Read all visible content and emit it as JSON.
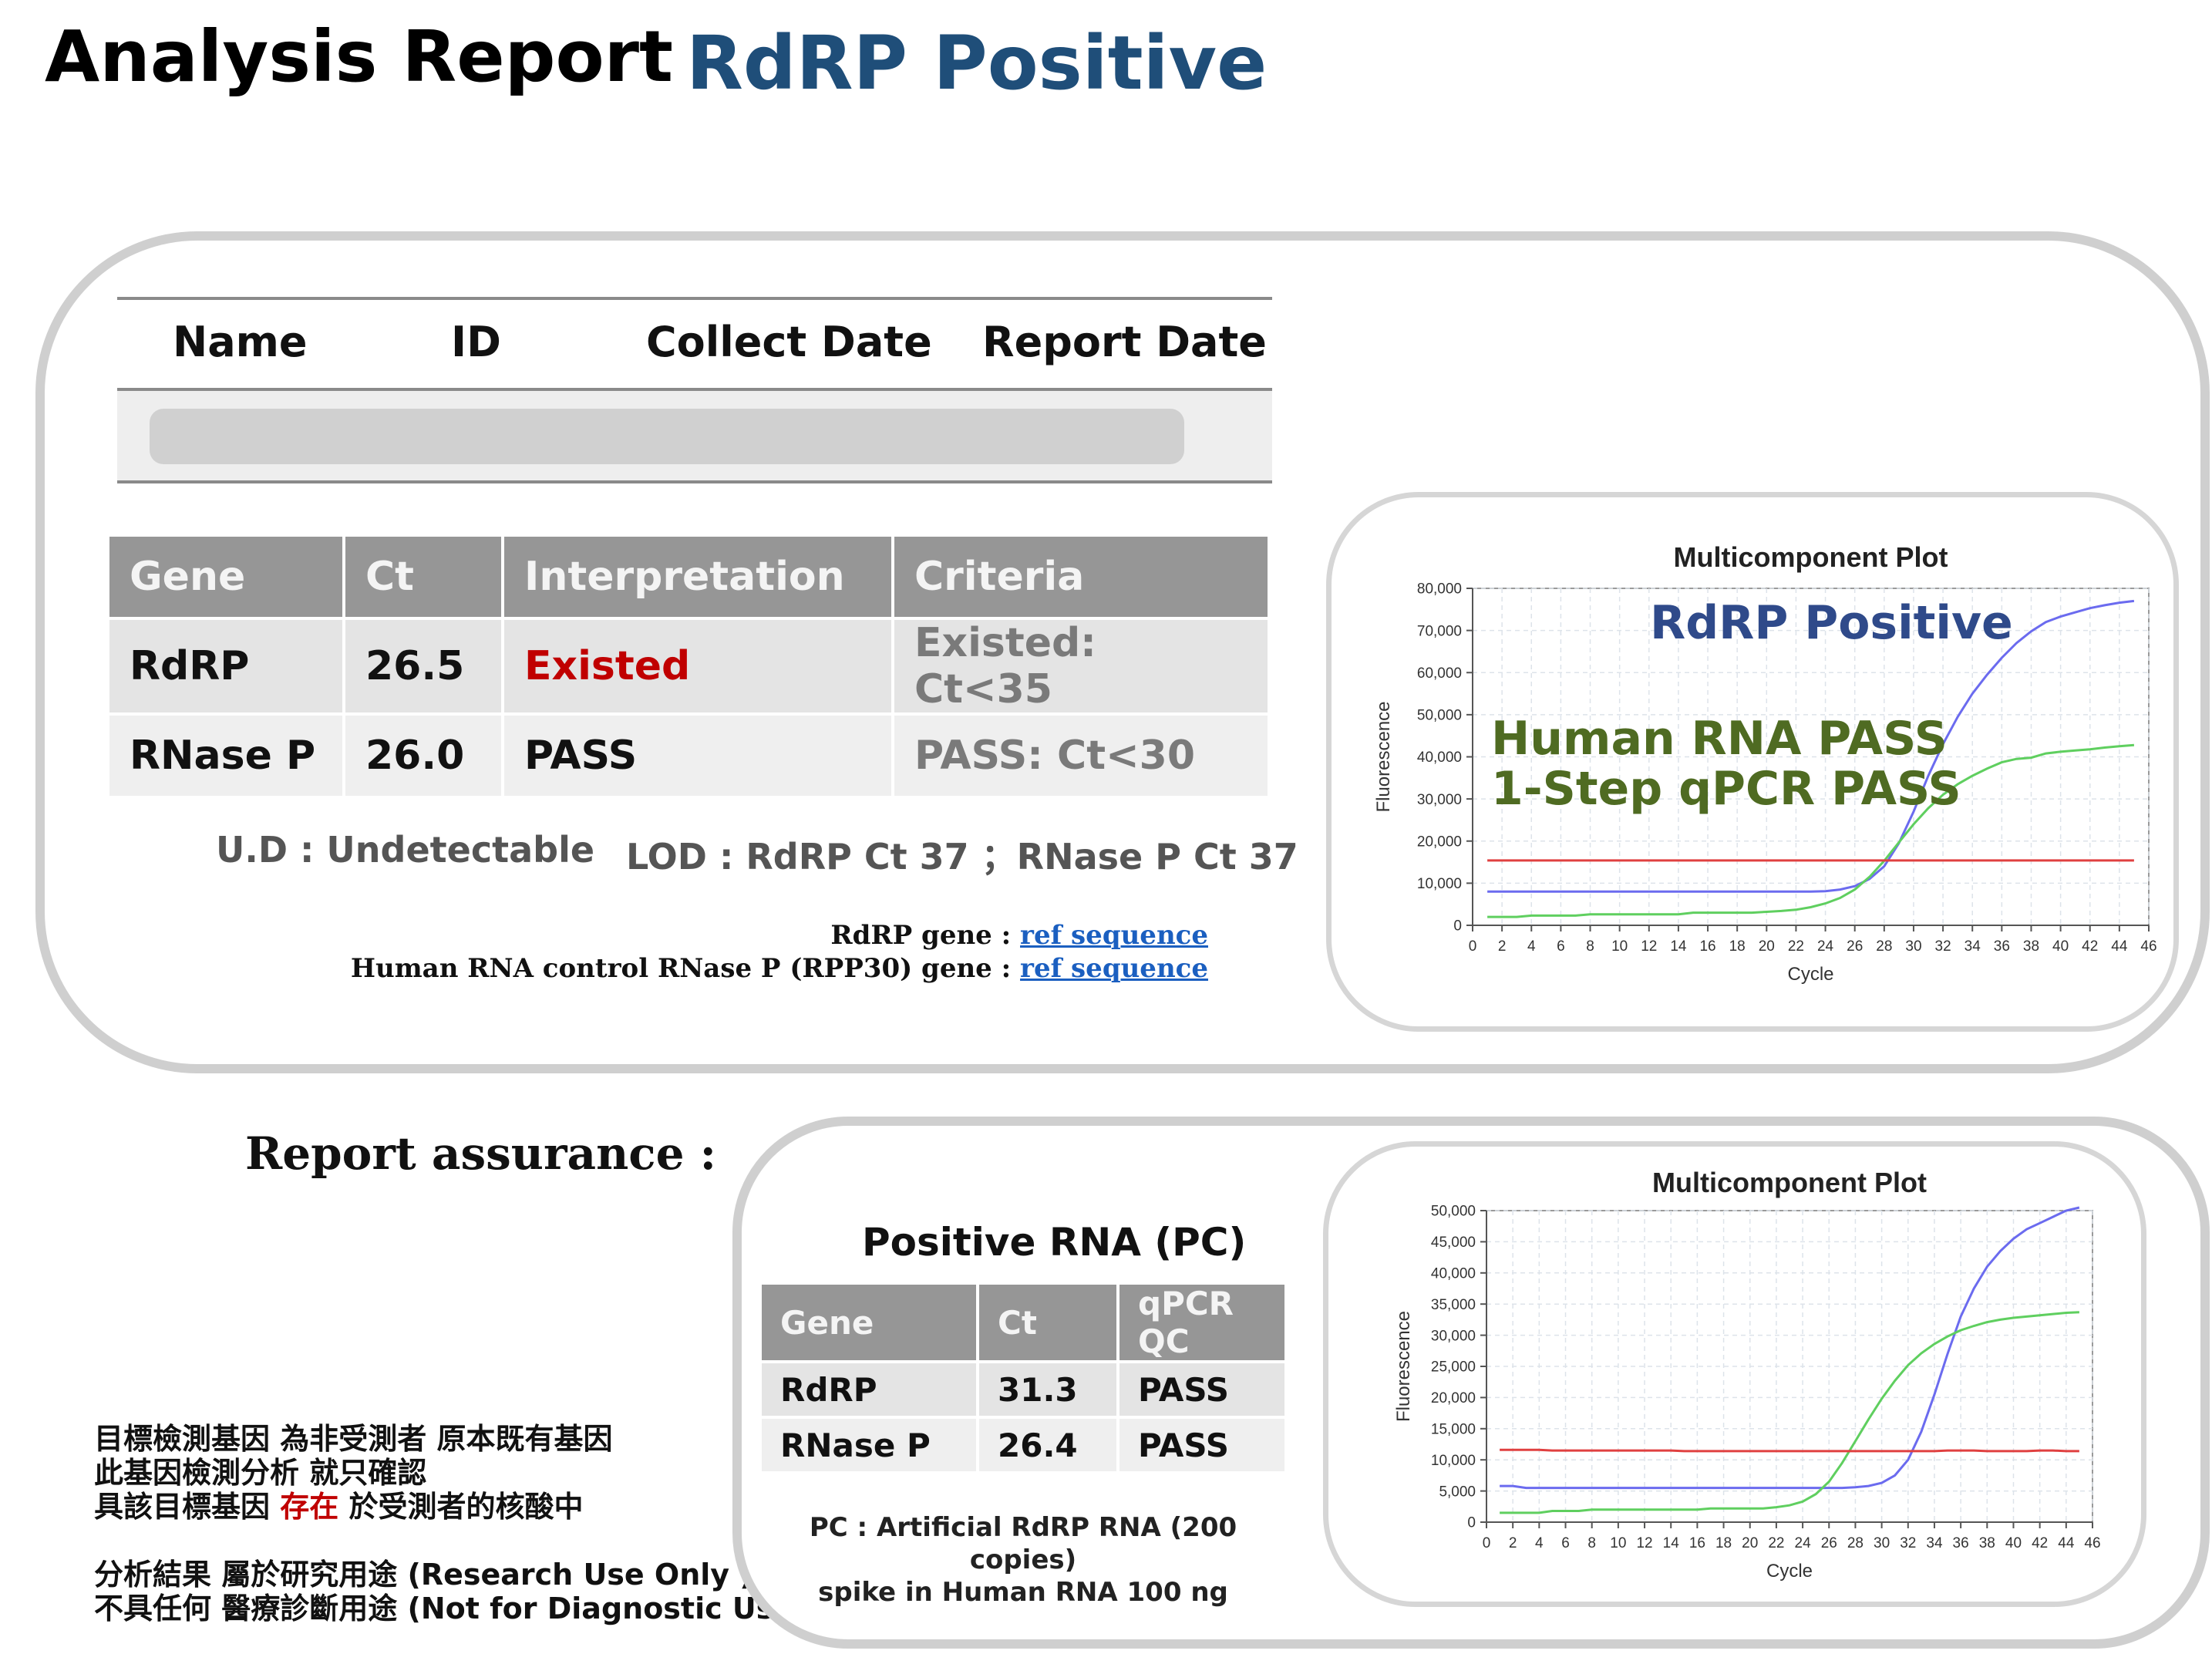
{
  "header": {
    "title": "Analysis Report",
    "subtitle": "RdRP Positive"
  },
  "patient": {
    "columns": [
      "Name",
      "ID",
      "Collect Date",
      "Report Date"
    ]
  },
  "results": {
    "headers": [
      "Gene",
      "Ct",
      "Interpretation",
      "Criteria"
    ],
    "rows": [
      {
        "gene": "RdRP",
        "ct": "26.5",
        "interpretation": "Existed",
        "criteria": "Existed: Ct<35"
      },
      {
        "gene": "RNase P",
        "ct": "26.0",
        "interpretation": "PASS",
        "criteria": "PASS: Ct<30"
      }
    ],
    "note_ud": "U.D : Undetectable",
    "note_lod": "LOD : RdRP Ct 37 ；RNase P Ct 37",
    "ref1_label": "RdRP gene : ",
    "ref2_label": "Human RNA control  RNase P (RPP30) gene : ",
    "ref_link": "ref sequence",
    "colors": {
      "existed": "#c00000",
      "header_bg": "#969696"
    }
  },
  "plot1": {
    "overlay_positive": "RdRP Positive",
    "overlay_human": "Human RNA PASS",
    "overlay_qpcr": "1-Step qPCR PASS"
  },
  "assurance": {
    "title": "Report assurance :",
    "line1": "目標檢測基因 為非受測者 原本既有基因",
    "line2": "此基因檢測分析 就只確認",
    "line3a": "具該目標基因 ",
    "line3b": "存在",
    "line3c": " 於受測者的核酸中",
    "line4": "分析結果 屬於研究用途 (Research Use Only )",
    "line5": "不具任何 醫療診斷用途 (Not for Diagnostic Use)"
  },
  "pc": {
    "title": "Positive RNA (PC)",
    "headers": [
      "Gene",
      "Ct",
      "qPCR QC"
    ],
    "rows": [
      {
        "gene": "RdRP",
        "ct": "31.3",
        "qc": "PASS"
      },
      {
        "gene": "RNase P",
        "ct": "26.4",
        "qc": "PASS"
      }
    ],
    "note1": "PC : Artificial RdRP RNA (200 copies)",
    "note2": "spike in Human RNA 100 ng"
  },
  "chart_data": [
    {
      "type": "line",
      "title": "Multicomponent Plot",
      "xlabel": "Cycle",
      "ylabel": "Fluorescence",
      "xlim": [
        0,
        46
      ],
      "ylim": [
        0,
        80000
      ],
      "xticks": [
        0,
        2,
        4,
        6,
        8,
        10,
        12,
        14,
        16,
        18,
        20,
        22,
        24,
        26,
        28,
        30,
        32,
        34,
        36,
        38,
        40,
        42,
        44,
        46
      ],
      "yticks": [
        0,
        10000,
        20000,
        30000,
        40000,
        50000,
        60000,
        70000,
        80000
      ],
      "ytick_labels": [
        "0",
        "10,000",
        "20,000",
        "30,000",
        "40,000",
        "50,000",
        "60,000",
        "70,000",
        "80,000"
      ],
      "grid": true,
      "x": [
        1,
        2,
        3,
        4,
        5,
        6,
        7,
        8,
        9,
        10,
        11,
        12,
        13,
        14,
        15,
        16,
        17,
        18,
        19,
        20,
        21,
        22,
        23,
        24,
        25,
        26,
        27,
        28,
        29,
        30,
        31,
        32,
        33,
        34,
        35,
        36,
        37,
        38,
        39,
        40,
        41,
        42,
        43,
        44,
        45
      ],
      "series": [
        {
          "color": "#6b6bef",
          "values": [
            8000,
            8000,
            8000,
            8000,
            8000,
            8000,
            8000,
            8000,
            8000,
            8000,
            8000,
            8000,
            8000,
            8000,
            8000,
            8000,
            8000,
            8000,
            8000,
            8000,
            8000,
            8000,
            8000,
            8100,
            8500,
            9300,
            11000,
            14000,
            19500,
            27000,
            35500,
            43000,
            49500,
            55000,
            59500,
            63500,
            67000,
            69800,
            72000,
            73300,
            74300,
            75300,
            76000,
            76600,
            77000
          ]
        },
        {
          "color": "#5fcf5f",
          "values": [
            2000,
            2000,
            2000,
            2300,
            2300,
            2300,
            2300,
            2600,
            2600,
            2600,
            2600,
            2600,
            2600,
            2600,
            3000,
            3000,
            3000,
            3000,
            3000,
            3200,
            3400,
            3700,
            4300,
            5200,
            6500,
            8500,
            11500,
            15300,
            19700,
            24000,
            27800,
            31000,
            33500,
            35500,
            37200,
            38700,
            39500,
            39800,
            40800,
            41200,
            41500,
            41800,
            42200,
            42500,
            42800
          ]
        },
        {
          "color": "#e04040",
          "values": [
            15400,
            15400,
            15400,
            15400,
            15400,
            15400,
            15400,
            15400,
            15400,
            15400,
            15400,
            15400,
            15400,
            15400,
            15400,
            15400,
            15400,
            15400,
            15400,
            15400,
            15400,
            15400,
            15400,
            15400,
            15400,
            15400,
            15400,
            15400,
            15400,
            15400,
            15400,
            15400,
            15400,
            15400,
            15400,
            15400,
            15400,
            15400,
            15400,
            15400,
            15400,
            15400,
            15400,
            15400,
            15400
          ]
        }
      ]
    },
    {
      "type": "line",
      "title": "Multicomponent Plot",
      "xlabel": "Cycle",
      "ylabel": "Fluorescence",
      "xlim": [
        0,
        46
      ],
      "ylim": [
        0,
        50000
      ],
      "xticks": [
        0,
        2,
        4,
        6,
        8,
        10,
        12,
        14,
        16,
        18,
        20,
        22,
        24,
        26,
        28,
        30,
        32,
        34,
        36,
        38,
        40,
        42,
        44,
        46
      ],
      "yticks": [
        0,
        5000,
        10000,
        15000,
        20000,
        25000,
        30000,
        35000,
        40000,
        45000,
        50000
      ],
      "ytick_labels": [
        "0",
        "5,000",
        "10,000",
        "15,000",
        "20,000",
        "25,000",
        "30,000",
        "35,000",
        "40,000",
        "45,000",
        "50,000"
      ],
      "grid": true,
      "x": [
        1,
        2,
        3,
        4,
        5,
        6,
        7,
        8,
        9,
        10,
        11,
        12,
        13,
        14,
        15,
        16,
        17,
        18,
        19,
        20,
        21,
        22,
        23,
        24,
        25,
        26,
        27,
        28,
        29,
        30,
        31,
        32,
        33,
        34,
        35,
        36,
        37,
        38,
        39,
        40,
        41,
        42,
        43,
        44,
        45
      ],
      "series": [
        {
          "color": "#6b6bef",
          "values": [
            5800,
            5800,
            5500,
            5500,
            5500,
            5500,
            5500,
            5500,
            5500,
            5500,
            5500,
            5500,
            5500,
            5500,
            5500,
            5500,
            5500,
            5500,
            5500,
            5500,
            5500,
            5500,
            5500,
            5500,
            5500,
            5500,
            5500,
            5600,
            5800,
            6300,
            7500,
            10000,
            14500,
            20500,
            27000,
            33000,
            37500,
            41000,
            43500,
            45500,
            47000,
            48000,
            49000,
            50000,
            50500
          ]
        },
        {
          "color": "#5fcf5f",
          "values": [
            1500,
            1500,
            1500,
            1500,
            1800,
            1800,
            1800,
            2000,
            2000,
            2000,
            2000,
            2000,
            2000,
            2000,
            2000,
            2000,
            2200,
            2200,
            2200,
            2200,
            2200,
            2400,
            2700,
            3300,
            4500,
            6500,
            9500,
            13000,
            16500,
            19800,
            22700,
            25200,
            27100,
            28600,
            29800,
            30800,
            31500,
            32100,
            32500,
            32800,
            33000,
            33200,
            33400,
            33600,
            33700
          ]
        },
        {
          "color": "#e04040",
          "values": [
            11600,
            11600,
            11600,
            11600,
            11500,
            11500,
            11500,
            11500,
            11500,
            11500,
            11500,
            11500,
            11500,
            11500,
            11400,
            11400,
            11400,
            11400,
            11400,
            11400,
            11400,
            11400,
            11400,
            11400,
            11400,
            11400,
            11400,
            11400,
            11400,
            11400,
            11400,
            11400,
            11400,
            11400,
            11500,
            11500,
            11500,
            11400,
            11400,
            11400,
            11400,
            11500,
            11500,
            11400,
            11400
          ]
        }
      ]
    }
  ]
}
